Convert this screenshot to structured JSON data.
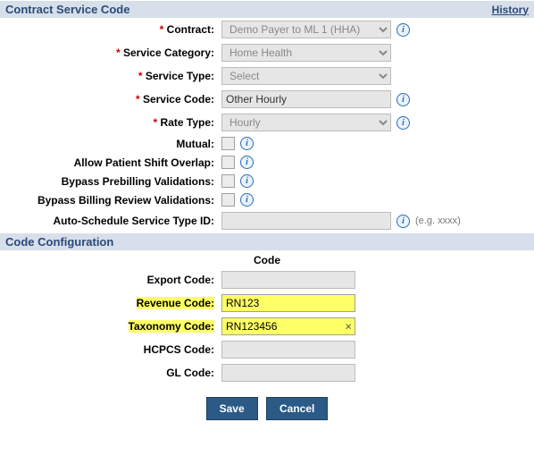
{
  "sections": {
    "contract": {
      "title": "Contract Service Code",
      "history_link": "History"
    },
    "codeconfig": {
      "title": "Code Configuration",
      "subheader": "Code"
    }
  },
  "labels": {
    "contract": "Contract:",
    "service_category": "Service Category:",
    "service_type": "Service Type:",
    "service_code": "Service Code:",
    "rate_type": "Rate Type:",
    "mutual": "Mutual:",
    "allow_overlap": "Allow Patient Shift Overlap:",
    "bypass_prebilling": "Bypass Prebilling Validations:",
    "bypass_billing_review": "Bypass Billing Review Validations:",
    "auto_schedule_id": "Auto-Schedule Service Type ID:",
    "export_code": "Export Code:",
    "revenue_code": "Revenue Code:",
    "taxonomy_code": "Taxonomy Code:",
    "hcpcs_code": "HCPCS Code:",
    "gl_code": "GL Code:"
  },
  "values": {
    "contract": "Demo Payer to ML 1 (HHA)",
    "service_category": "Home Health",
    "service_type": "Select",
    "service_code": "Other Hourly",
    "rate_type": "Hourly",
    "mutual": false,
    "allow_overlap": false,
    "bypass_prebilling": false,
    "bypass_billing_review": false,
    "auto_schedule_id": "",
    "export_code": "",
    "revenue_code": "RN123",
    "taxonomy_code": "RN123456",
    "hcpcs_code": "",
    "gl_code": ""
  },
  "hints": {
    "auto_schedule_id": "(e.g. xxxx)"
  },
  "buttons": {
    "save": "Save",
    "cancel": "Cancel"
  },
  "icons": {
    "info": "i",
    "clear": "×"
  }
}
